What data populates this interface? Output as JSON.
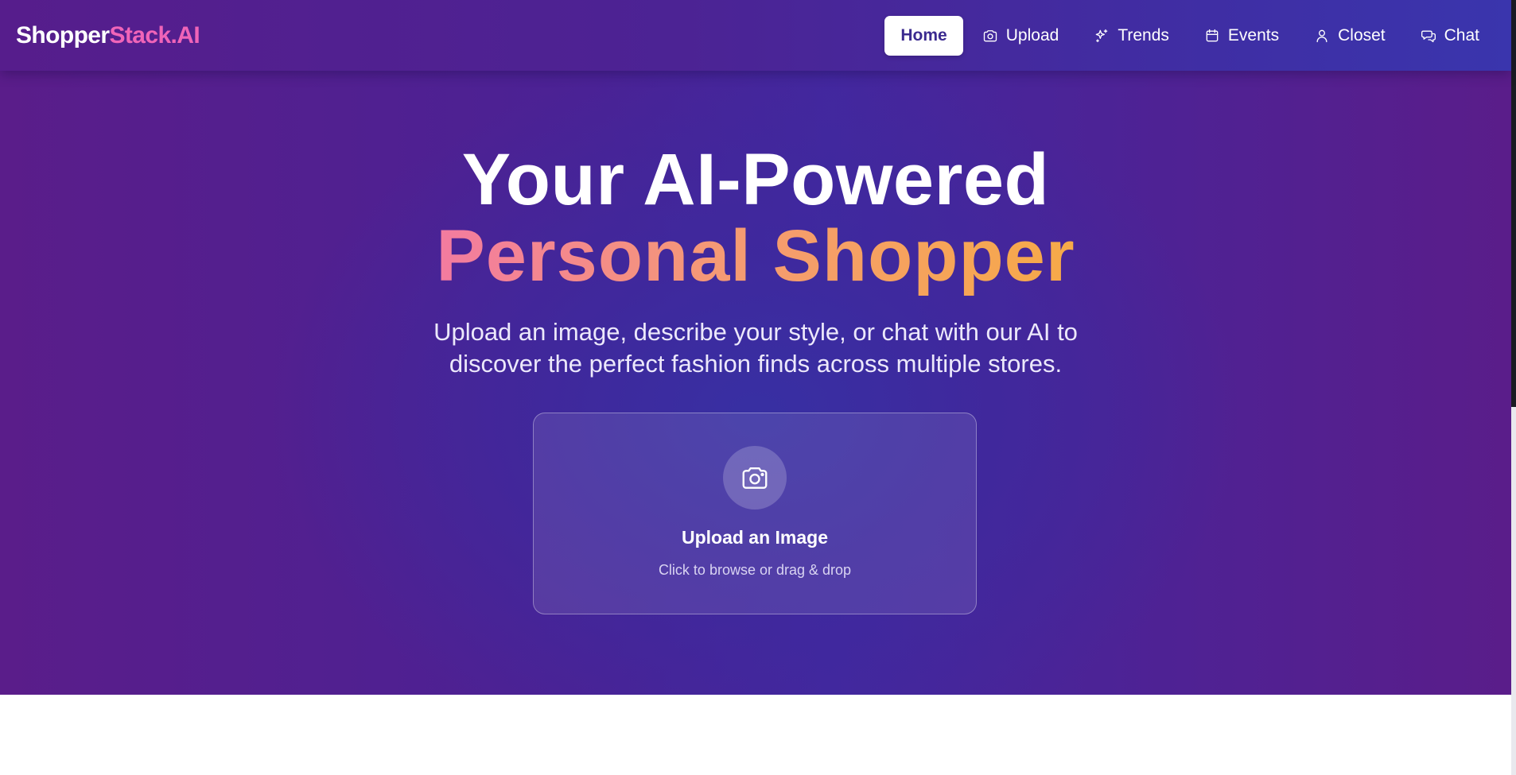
{
  "brand": {
    "name_main": "Shopper",
    "name_accent": "Stack.AI",
    "accent_color": "#f064b8"
  },
  "nav": {
    "items": [
      {
        "label": "Home",
        "icon": "",
        "active": true
      },
      {
        "label": "Upload",
        "icon": "camera-icon",
        "active": false
      },
      {
        "label": "Trends",
        "icon": "sparkles-icon",
        "active": false
      },
      {
        "label": "Events",
        "icon": "calendar-icon",
        "active": false
      },
      {
        "label": "Closet",
        "icon": "user-icon",
        "active": false
      },
      {
        "label": "Chat",
        "icon": "chat-bubbles-icon",
        "active": false
      }
    ]
  },
  "hero": {
    "title_line1": "Your AI-Powered",
    "title_line2": "Personal Shopper",
    "subtitle_line1": "Upload an image, describe your style, or chat with our AI to",
    "subtitle_line2": "discover the perfect fashion finds across multiple stores."
  },
  "upload_card": {
    "icon": "camera-icon",
    "title": "Upload an Image",
    "hint": "Click to browse or drag & drop"
  },
  "colors": {
    "hero_gradient_start": "#5a1d8a",
    "hero_gradient_center": "#43279e",
    "headline_gradient_start": "#f37ba0",
    "headline_gradient_end": "#f6aa48"
  }
}
